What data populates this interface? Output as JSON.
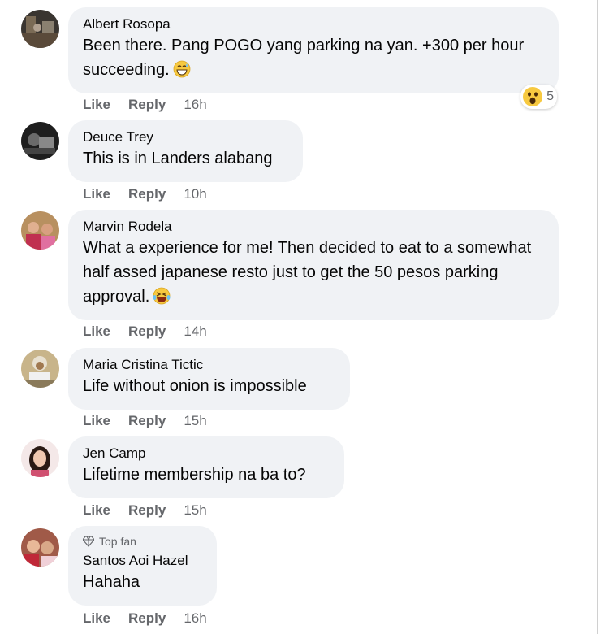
{
  "comments": [
    {
      "author": "Albert Rosopa",
      "text": "Been there. Pang POGO yang parking na yan. +300 per hour succeeding.",
      "emoji": "grin-sweat",
      "reaction_emoji": "wow",
      "reaction_count": "5",
      "like_label": "Like",
      "reply_label": "Reply",
      "time": "16h"
    },
    {
      "author": "Deuce Trey",
      "text": "This is in Landers alabang",
      "like_label": "Like",
      "reply_label": "Reply",
      "time": "10h"
    },
    {
      "author": "Marvin Rodela",
      "text": "What a experience for me! Then decided to eat to a somewhat half assed japanese resto just to get the 50 pesos parking approval.",
      "emoji": "laughing-tears",
      "like_label": "Like",
      "reply_label": "Reply",
      "time": "14h"
    },
    {
      "author": "Maria Cristina Tictic",
      "text": "Life without onion is impossible",
      "like_label": "Like",
      "reply_label": "Reply",
      "time": "15h"
    },
    {
      "author": "Jen Camp",
      "text": "Lifetime membership na ba to?",
      "like_label": "Like",
      "reply_label": "Reply",
      "time": "15h"
    },
    {
      "author": "Santos Aoi Hazel",
      "badge": "Top fan",
      "text": "Hahaha",
      "like_label": "Like",
      "reply_label": "Reply",
      "time": "16h"
    }
  ],
  "colors": {
    "bubble": "#f0f2f5",
    "meta_text": "#65676b",
    "body_text": "#050505"
  }
}
